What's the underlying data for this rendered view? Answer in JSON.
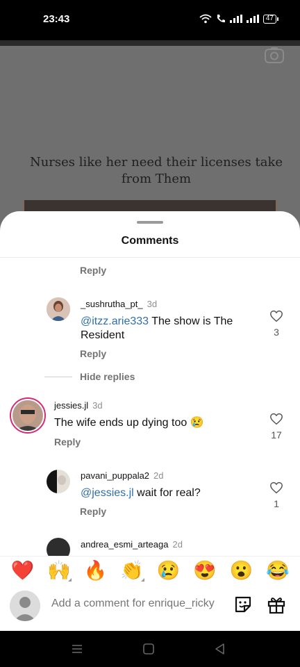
{
  "status_bar": {
    "time": "23:43",
    "battery": "47"
  },
  "post": {
    "caption": "Nurses like her need their licenses take from Them",
    "camera_icon": "camera-icon"
  },
  "sheet": {
    "title": "Comments"
  },
  "thread": {
    "top_reply": "Reply",
    "comments": [
      {
        "username": "_sushrutha_pt_",
        "age": "3d",
        "mention": "@itzz.arie333",
        "text": " The show is The Resident",
        "reply": "Reply",
        "likes": "3"
      },
      {
        "username": "jessies.jl",
        "age": "3d",
        "text": "The wife ends up dying too 😢",
        "reply": "Reply",
        "likes": "17"
      },
      {
        "username": "pavani_puppala2",
        "age": "2d",
        "mention": "@jessies.jl",
        "text": " wait for real?",
        "reply": "Reply",
        "likes": "1"
      },
      {
        "username": "andrea_esmi_arteaga",
        "age": "2d"
      }
    ],
    "hide_replies": "Hide replies"
  },
  "emoji_bar": [
    "❤️",
    "🙌",
    "🔥",
    "👏",
    "😢",
    "😍",
    "😮",
    "😂"
  ],
  "input": {
    "placeholder": "Add a comment for enrique_ricky"
  },
  "colors": {
    "mention": "#2f6ea8",
    "heart": "#e0245e",
    "story_ring": "#d62976"
  }
}
